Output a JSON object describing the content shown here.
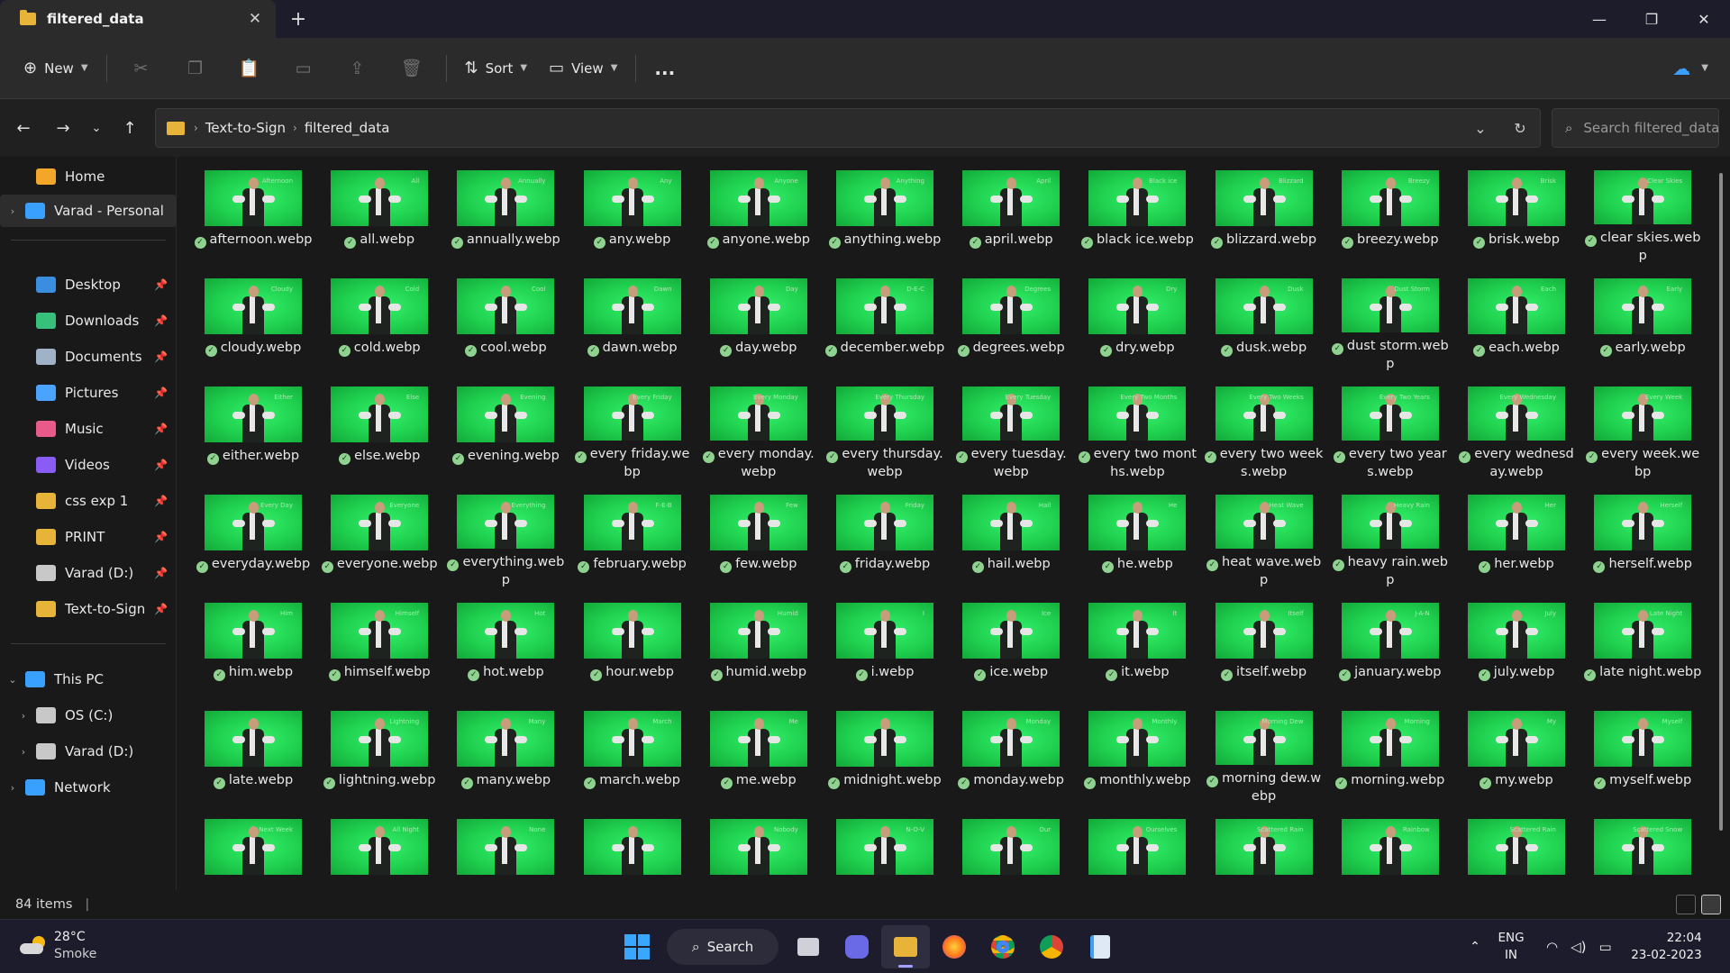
{
  "window": {
    "tab_title": "filtered_data",
    "controls": [
      "minimize-icon",
      "restore-icon",
      "close-icon"
    ]
  },
  "toolbar": {
    "new_label": "New",
    "sort_label": "Sort",
    "view_label": "View",
    "more_label": "...",
    "disabled_icons": [
      "cut-icon",
      "copy-icon",
      "paste-icon",
      "rename-icon",
      "share-icon",
      "delete-icon"
    ]
  },
  "address": {
    "crumbs": [
      "Text-to-Sign",
      "filtered_data"
    ],
    "search_placeholder": "Search filtered_data"
  },
  "sidebar": {
    "top": [
      {
        "label": "Home",
        "icon": "home-icon",
        "color": "#f4a62a"
      },
      {
        "label": "Varad - Personal",
        "icon": "onedrive-cloud-icon",
        "color": "#3aa0ff",
        "selected": true
      }
    ],
    "quick": [
      {
        "label": "Desktop",
        "icon": "desktop-icon",
        "color": "#3b8de0"
      },
      {
        "label": "Downloads",
        "icon": "download-icon",
        "color": "#36c07a"
      },
      {
        "label": "Documents",
        "icon": "documents-icon",
        "color": "#9fb2c8"
      },
      {
        "label": "Pictures",
        "icon": "pictures-icon",
        "color": "#4aa3ff"
      },
      {
        "label": "Music",
        "icon": "music-icon",
        "color": "#e85a8a"
      },
      {
        "label": "Videos",
        "icon": "videos-icon",
        "color": "#8a5cf6"
      },
      {
        "label": "css exp 1",
        "icon": "folder-icon",
        "color": "#e8b339"
      },
      {
        "label": "PRINT",
        "icon": "folder-icon",
        "color": "#e8b339"
      },
      {
        "label": "Varad (D:)",
        "icon": "drive-icon",
        "color": "#c8c8c8"
      },
      {
        "label": "Text-to-Sign",
        "icon": "folder-icon",
        "color": "#e8b339"
      }
    ],
    "pc": [
      {
        "label": "This PC",
        "icon": "pc-icon",
        "color": "#3aa0ff",
        "expanded": true,
        "indent": 0
      },
      {
        "label": "OS (C:)",
        "icon": "drive-icon",
        "color": "#c8c8c8",
        "indent": 1
      },
      {
        "label": "Varad (D:)",
        "icon": "drive-icon",
        "color": "#c8c8c8",
        "indent": 1
      },
      {
        "label": "Network",
        "icon": "network-icon",
        "color": "#3aa0ff",
        "indent": 0
      }
    ]
  },
  "files": [
    {
      "name": "afternoon.webp",
      "tag": "Afternoon"
    },
    {
      "name": "all.webp",
      "tag": "All"
    },
    {
      "name": "annually.webp",
      "tag": "Annually"
    },
    {
      "name": "any.webp",
      "tag": "Any"
    },
    {
      "name": "anyone.webp",
      "tag": "Anyone"
    },
    {
      "name": "anything.webp",
      "tag": "Anything"
    },
    {
      "name": "april.webp",
      "tag": "April"
    },
    {
      "name": "black ice.webp",
      "tag": "Black ice"
    },
    {
      "name": "blizzard.webp",
      "tag": "Blizzard"
    },
    {
      "name": "breezy.webp",
      "tag": "Breezy"
    },
    {
      "name": "brisk.webp",
      "tag": "Brisk"
    },
    {
      "name": "clear skies.webp",
      "tag": "Clear Skies"
    },
    {
      "name": "cloudy.webp",
      "tag": "Cloudy"
    },
    {
      "name": "cold.webp",
      "tag": "Cold"
    },
    {
      "name": "cool.webp",
      "tag": "Cool"
    },
    {
      "name": "dawn.webp",
      "tag": "Dawn"
    },
    {
      "name": "day.webp",
      "tag": "Day"
    },
    {
      "name": "december.webp",
      "tag": "D-E-C"
    },
    {
      "name": "degrees.webp",
      "tag": "Degrees"
    },
    {
      "name": "dry.webp",
      "tag": "Dry"
    },
    {
      "name": "dusk.webp",
      "tag": "Dusk"
    },
    {
      "name": "dust storm.webp",
      "tag": "Dust Storm"
    },
    {
      "name": "each.webp",
      "tag": "Each"
    },
    {
      "name": "early.webp",
      "tag": "Early"
    },
    {
      "name": "either.webp",
      "tag": "Either"
    },
    {
      "name": "else.webp",
      "tag": "Else"
    },
    {
      "name": "evening.webp",
      "tag": "Evening"
    },
    {
      "name": "every friday.webp",
      "tag": "Every Friday"
    },
    {
      "name": "every monday.webp",
      "tag": "Every Monday"
    },
    {
      "name": "every thursday.webp",
      "tag": "Every Thursday"
    },
    {
      "name": "every tuesday.webp",
      "tag": "Every Tuesday"
    },
    {
      "name": "every two months.webp",
      "tag": "Every Two Months"
    },
    {
      "name": "every two weeks.webp",
      "tag": "Every Two Weeks"
    },
    {
      "name": "every two years.webp",
      "tag": "Every Two Years"
    },
    {
      "name": "every wednesday.webp",
      "tag": "Every Wednesday"
    },
    {
      "name": "every week.webp",
      "tag": "Every Week"
    },
    {
      "name": "everyday.webp",
      "tag": "Every Day"
    },
    {
      "name": "everyone.webp",
      "tag": "Everyone"
    },
    {
      "name": "everything.webp",
      "tag": "Everything"
    },
    {
      "name": "february.webp",
      "tag": "F-E-B"
    },
    {
      "name": "few.webp",
      "tag": "Few"
    },
    {
      "name": "friday.webp",
      "tag": "Friday"
    },
    {
      "name": "hail.webp",
      "tag": "Hail"
    },
    {
      "name": "he.webp",
      "tag": "He"
    },
    {
      "name": "heat wave.webp",
      "tag": "Heat Wave"
    },
    {
      "name": "heavy rain.webp",
      "tag": "Heavy Rain"
    },
    {
      "name": "her.webp",
      "tag": "Her"
    },
    {
      "name": "herself.webp",
      "tag": "Herself"
    },
    {
      "name": "him.webp",
      "tag": "Him"
    },
    {
      "name": "himself.webp",
      "tag": "Himself"
    },
    {
      "name": "hot.webp",
      "tag": "Hot"
    },
    {
      "name": "hour.webp",
      "tag": ""
    },
    {
      "name": "humid.webp",
      "tag": "Humid"
    },
    {
      "name": "i.webp",
      "tag": "I"
    },
    {
      "name": "ice.webp",
      "tag": "Ice"
    },
    {
      "name": "it.webp",
      "tag": "It"
    },
    {
      "name": "itself.webp",
      "tag": "Itself"
    },
    {
      "name": "january.webp",
      "tag": "J-A-N"
    },
    {
      "name": "july.webp",
      "tag": "July"
    },
    {
      "name": "late night.webp",
      "tag": "Late Night"
    },
    {
      "name": "late.webp",
      "tag": ""
    },
    {
      "name": "lightning.webp",
      "tag": "Lightning"
    },
    {
      "name": "many.webp",
      "tag": "Many"
    },
    {
      "name": "march.webp",
      "tag": "March"
    },
    {
      "name": "me.webp",
      "tag": "Me"
    },
    {
      "name": "midnight.webp",
      "tag": ""
    },
    {
      "name": "monday.webp",
      "tag": "Monday"
    },
    {
      "name": "monthly.webp",
      "tag": "Monthly"
    },
    {
      "name": "morning dew.webp",
      "tag": "Morning Dew"
    },
    {
      "name": "morning.webp",
      "tag": "Morning"
    },
    {
      "name": "my.webp",
      "tag": "My"
    },
    {
      "name": "myself.webp",
      "tag": "Myself"
    },
    {
      "name": "",
      "tag": "Next Week"
    },
    {
      "name": "",
      "tag": "All Night"
    },
    {
      "name": "",
      "tag": "None"
    },
    {
      "name": "",
      "tag": ""
    },
    {
      "name": "",
      "tag": "Nobody"
    },
    {
      "name": "",
      "tag": "N-O-V"
    },
    {
      "name": "",
      "tag": "Our"
    },
    {
      "name": "",
      "tag": "Ourselves"
    },
    {
      "name": "",
      "tag": "Scattered Rain"
    },
    {
      "name": "",
      "tag": "Rainbow"
    },
    {
      "name": "",
      "tag": "Scattered Rain"
    },
    {
      "name": "",
      "tag": "Scattered Snow"
    }
  ],
  "status": {
    "item_count": "84 items",
    "separator": "|"
  },
  "taskbar": {
    "temperature": "28°C",
    "condition": "Smoke",
    "search_label": "Search",
    "lang_top": "ENG",
    "lang_bottom": "IN",
    "time": "22:04",
    "date": "23-02-2023"
  }
}
